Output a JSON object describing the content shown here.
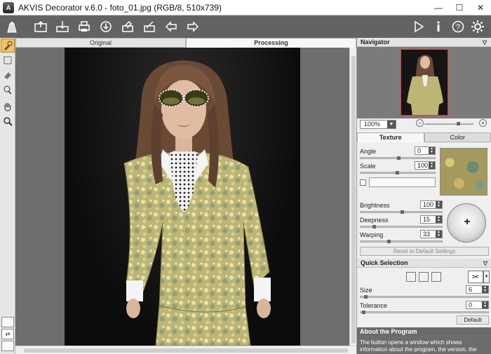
{
  "window": {
    "title": "AKVIS Decorator v.6.0 - foto_01.jpg (RGB/8, 510x739)",
    "minimize": "—",
    "maximize": "☐",
    "close": "✕"
  },
  "toolbar": {
    "left_icons": [
      "decorator-logo-icon",
      "open-icon",
      "save-icon",
      "print-icon",
      "share-icon",
      "load-settings-icon",
      "save-settings-icon",
      "undo-icon",
      "redo-icon"
    ],
    "right_icons": [
      "run-icon",
      "info-icon",
      "help-icon",
      "settings-icon"
    ]
  },
  "left_tools": [
    "texture-brush-icon",
    "selection-rect-icon",
    "eraser-icon",
    "color-picker-icon",
    "hand-icon",
    "zoom-icon"
  ],
  "canvas": {
    "tabs": {
      "original": "Original",
      "processing": "Processing"
    }
  },
  "navigator": {
    "title": "Navigator",
    "zoom": "100%",
    "zoom_minus": "−",
    "zoom_plus": "+"
  },
  "texture": {
    "tab_texture": "Texture",
    "tab_color": "Color",
    "angle_label": "Angle",
    "angle_value": "0",
    "scale_label": "Scale",
    "scale_value": "100",
    "brightness_label": "Brightness",
    "brightness_value": "100",
    "deepness_label": "Deepness",
    "deepness_value": "15",
    "warping_label": "Warping",
    "warping_value": "33",
    "reset_label": "Reset to Default Settings",
    "dial_symbol": "+"
  },
  "quick_selection": {
    "title": "Quick Selection",
    "size_label": "Size",
    "size_value": "6",
    "tolerance_label": "Tolerance",
    "tolerance_value": "0",
    "default_label": "Default"
  },
  "about": {
    "title": "About the Program",
    "text": "The button opens a window which shows information about the program, the version, the"
  },
  "colors": {
    "toolbar_bg": "#636363",
    "panel_bg": "#efefef",
    "active_tool": "#f5c15a"
  }
}
